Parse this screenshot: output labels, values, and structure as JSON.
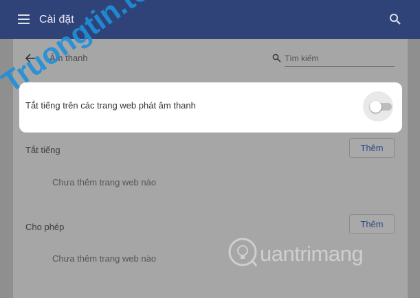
{
  "app_bar": {
    "title": "Cài đặt",
    "menu_icon": "hamburger-menu-icon",
    "search_icon": "search-icon"
  },
  "section": {
    "title": "Âm thanh",
    "back_icon": "arrow-left-icon"
  },
  "search": {
    "placeholder": "Tìm kiếm",
    "value": ""
  },
  "mute_setting": {
    "label": "Tắt tiếng trên các trang web phát âm thanh",
    "enabled": false
  },
  "groups": [
    {
      "heading": "Tắt tiếng",
      "button_label": "Thêm",
      "empty_text": "Chưa thêm trang web nào"
    },
    {
      "heading": "Cho phép",
      "button_label": "Thêm",
      "empty_text": "Chưa thêm trang web nào"
    }
  ],
  "watermarks": {
    "diagonal": "Truongtin.top",
    "bottom": "uantrimang",
    "bottom_icon": "lightbulb-logo-icon"
  },
  "colors": {
    "app_bar": "#304378",
    "accent_text": "#2f4a85",
    "highlight": "#ffffff",
    "overlay": "#a6a6a6"
  }
}
